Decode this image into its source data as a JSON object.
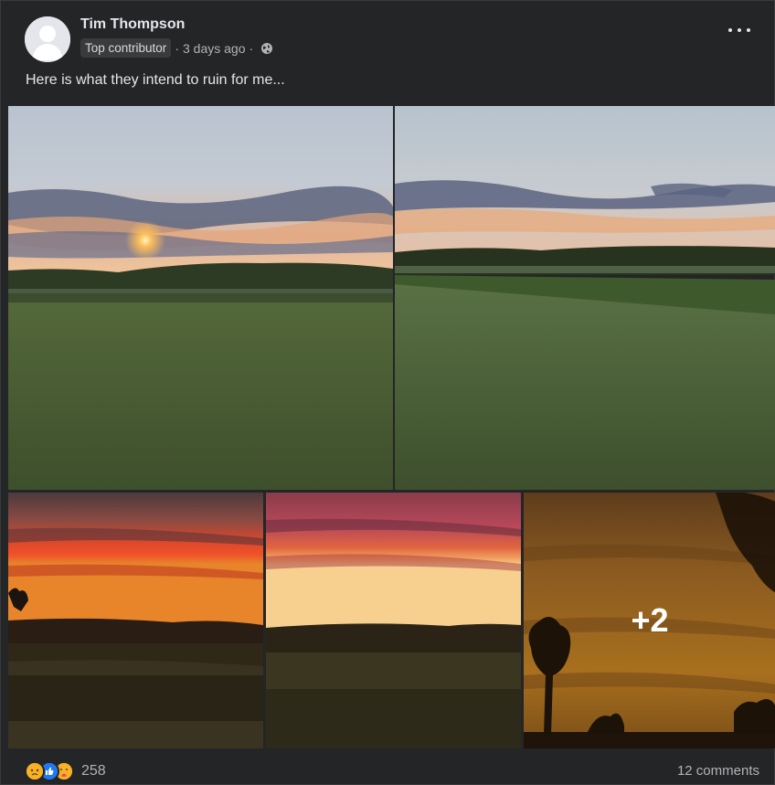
{
  "post": {
    "author": "Tim Thompson",
    "badge": "Top contributor",
    "separator_1": "·",
    "time": "3 days ago",
    "separator_2": "·",
    "audience_icon": "globe-icon",
    "menu_icon": "more-options-icon",
    "caption": "Here is what they intend to ruin for me..."
  },
  "photos": {
    "overflow_count": "+2"
  },
  "footer": {
    "reaction_icons": [
      "sad-reaction-icon",
      "like-reaction-icon",
      "care-reaction-icon"
    ],
    "reaction_count": "258",
    "comments": "12 comments"
  },
  "colors": {
    "background": "#242526",
    "text_primary": "#e4e6eb",
    "text_secondary": "#b0b3b8",
    "like_blue": "#2078f4",
    "reaction_yellow": "#f7b125"
  }
}
